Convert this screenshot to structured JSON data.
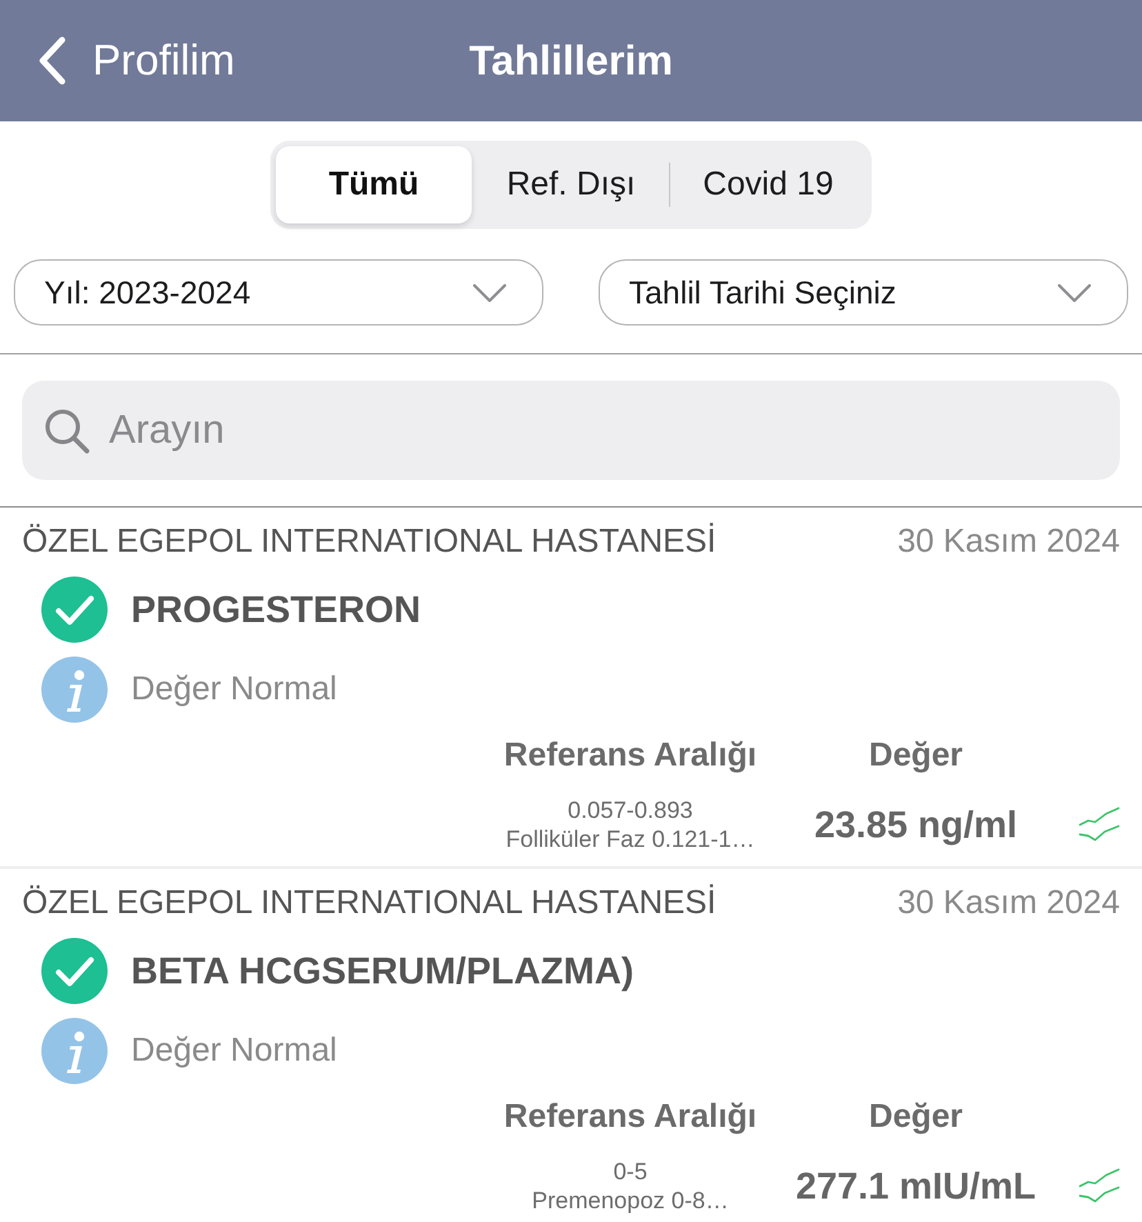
{
  "nav": {
    "back_label": "Profilim",
    "title": "Tahlillerim"
  },
  "segments": [
    {
      "label": "Tümü",
      "selected": true
    },
    {
      "label": "Ref. Dışı",
      "selected": false
    },
    {
      "label": "Covid 19",
      "selected": false
    }
  ],
  "filters": [
    {
      "label": "Yıl: 2023-2024"
    },
    {
      "label": "Tahlil Tarihi Seçiniz"
    }
  ],
  "search": {
    "placeholder": "Arayın"
  },
  "results": [
    {
      "hospital": "ÖZEL EGEPOL INTERNATIONAL HASTANESİ",
      "date": "30 Kasım 2024",
      "test": "PROGESTERON",
      "status": "Değer Normal",
      "reference_header": "Referans Aralığı",
      "value_header": "Değer",
      "reference_lines": [
        "0.057-0.893",
        "Folliküler Faz 0.121-1…"
      ],
      "value": "23.85 ng/ml"
    },
    {
      "hospital": "ÖZEL EGEPOL INTERNATIONAL HASTANESİ",
      "date": "30 Kasım 2024",
      "test": "BETA HCGSERUM/PLAZMA)",
      "status": "Değer Normal",
      "reference_header": "Referans Aralığı",
      "value_header": "Değer",
      "reference_lines": [
        "0-5",
        "Premenopoz 0-8…"
      ],
      "value": "277.1 mIU/mL"
    }
  ]
}
